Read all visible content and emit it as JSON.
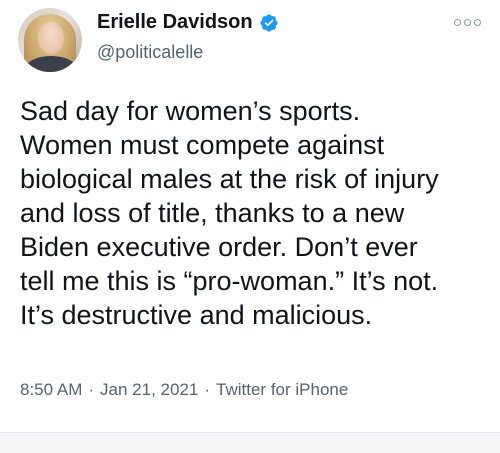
{
  "author": {
    "name": "Erielle Davidson",
    "handle": "@politicalelle",
    "verified": true,
    "verified_color": "#1d9bf0",
    "avatar_icon": "profile-photo"
  },
  "tweet": {
    "text": "Sad day for women’s sports.\nWomen must compete against\nbiological males at the risk of injury\nand loss of title, thanks to a new\nBiden executive order. Don’t ever\ntell me this is “pro-woman.” It’s not.\nIt’s destructive and malicious.",
    "time": "8:50 AM",
    "separator": "·",
    "date": "Jan 21, 2021",
    "source": "Twitter for iPhone"
  },
  "icons": {
    "more": "more-options-icon",
    "verified": "verified-badge-icon"
  }
}
